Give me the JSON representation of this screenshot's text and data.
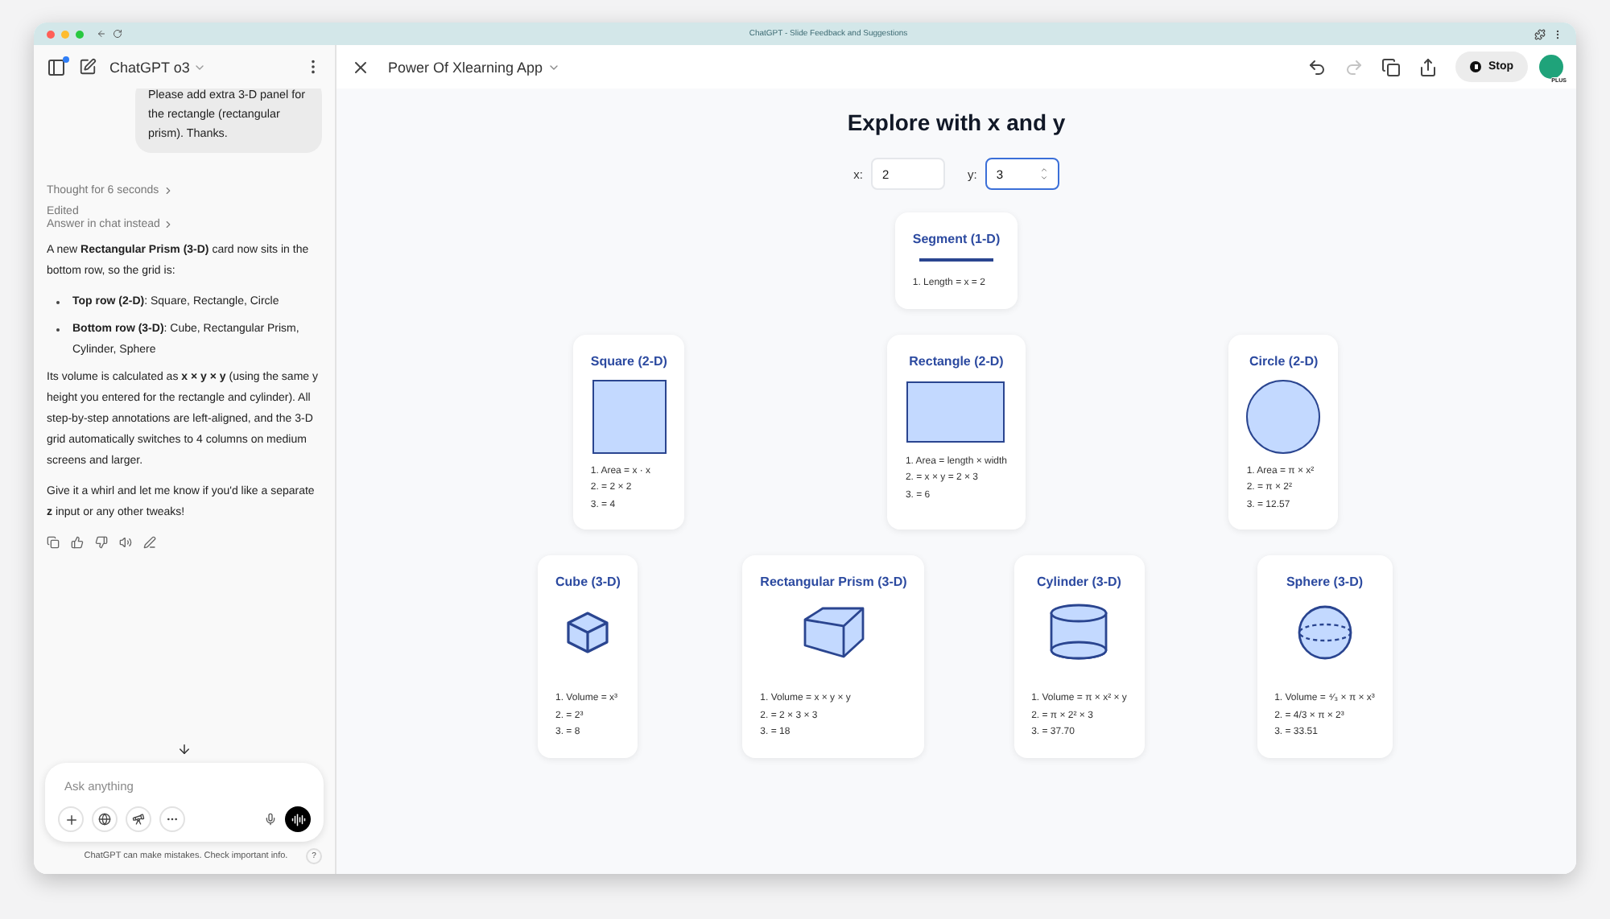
{
  "browser": {
    "title": "ChatGPT - Slide Feedback and Suggestions"
  },
  "sidebar": {
    "model": "ChatGPT o3",
    "toggle_badge": true,
    "user_message": "Please add extra 3-D panel for the rectangle (rectangular prism). Thanks.",
    "thought": "Thought for 6 seconds",
    "status": "Edited",
    "answer_link": "Answer in chat instead",
    "paragraphs": [
      {
        "kind": "text",
        "text": "A new **Rectangular Prism (3-D)** card now sits in the bottom row, so the grid is:"
      },
      {
        "kind": "bullet",
        "text": "**Top row (2-D)**: Square, Rectangle, Circle"
      },
      {
        "kind": "bullet",
        "text": "**Bottom row (3-D)**: Cube, Rectangular Prism, Cylinder, Sphere"
      },
      {
        "kind": "text",
        "text": "Its volume is calculated as **x × y × y** (using the same y height you entered for the rectangle and cylinder). All step-by-step annotations are left-aligned, and the 3-D grid automatically switches to 4 columns on medium screens and larger."
      },
      {
        "kind": "text",
        "text": "Give it a whirl and let me know if you'd like a separate **z** input or any other tweaks!"
      }
    ],
    "composer": {
      "placeholder": "Ask anything"
    },
    "disclaimer": "ChatGPT can make mistakes. Check important info.",
    "help": "?"
  },
  "canvas": {
    "title": "Power Of Xlearning App",
    "toolbar": [
      {
        "kind": "undo",
        "disabled": false
      },
      {
        "kind": "redo",
        "disabled": true
      },
      {
        "kind": "copy",
        "disabled": false
      },
      {
        "kind": "share",
        "disabled": false
      }
    ],
    "stop_label": "Stop",
    "avatar_badge": "PLUS"
  },
  "app": {
    "heading": "Explore with x and y",
    "inputs": [
      {
        "label": "x:",
        "value": "2",
        "focused": false
      },
      {
        "label": "y:",
        "value": "3",
        "focused": true
      }
    ],
    "card_rows": [
      {
        "cards": [
          {
            "kind": "segment",
            "title": "Segment (1-D)",
            "steps": [
              "1. Length = x = 2"
            ]
          }
        ]
      },
      {
        "cards": [
          {
            "kind": "square",
            "title": "Square (2-D)",
            "steps": [
              "1. Area = x · x",
              "2. = 2 × 2",
              "3. = 4"
            ]
          },
          {
            "kind": "rectangle",
            "title": "Rectangle (2-D)",
            "steps": [
              "1. Area = length × width",
              "2. = x × y = 2 × 3",
              "3. = 6"
            ]
          },
          {
            "kind": "circle",
            "title": "Circle (2-D)",
            "steps": [
              "1. Area = π × x²",
              "2. = π × 2²",
              "3. = 12.57"
            ]
          }
        ]
      },
      {
        "cards": [
          {
            "kind": "cube",
            "title": "Cube (3-D)",
            "steps": [
              "1. Volume = x³",
              "2. = 2³",
              "3. = 8"
            ]
          },
          {
            "kind": "prism",
            "title": "Rectangular Prism (3-D)",
            "steps": [
              "1. Volume = x × y × y",
              "2. = 2 × 3 × 3",
              "3. = 18"
            ]
          },
          {
            "kind": "cylinder",
            "title": "Cylinder (3-D)",
            "steps": [
              "1. Volume = π × x² × y",
              "2. = π × 2² × 3",
              "3. = 37.70"
            ]
          },
          {
            "kind": "sphere",
            "title": "Sphere (3-D)",
            "steps": [
              "1. Volume = ⁴⁄₃ × π × x³",
              "2. = 4/3 × π × 2³",
              "3. = 33.51"
            ]
          }
        ]
      }
    ]
  }
}
